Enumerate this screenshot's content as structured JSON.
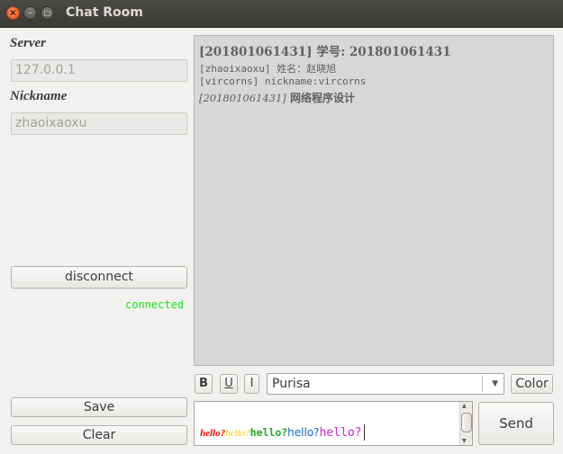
{
  "window": {
    "title": "Chat Room",
    "close_glyph": "×",
    "min_glyph": "–",
    "max_glyph": "□"
  },
  "sidebar": {
    "server_label": "Server",
    "server_value": "127.0.0.1",
    "nickname_label": "Nickname",
    "nickname_value": "zhaoixaoxu",
    "disconnect_label": "disconnect",
    "status_text": "connected",
    "status_color": "#22dd22",
    "save_label": "Save",
    "clear_label": "Clear"
  },
  "chat": {
    "line1": "[201801061431] 学号: 201801061431",
    "line2": "[zhaoixaoxu] 姓名：赵晓旭",
    "line3": "[vircorns] nickname:vircorns",
    "line4_sender": "[201801061431]",
    "line4_text": "网络程序设计"
  },
  "toolbar": {
    "bold_label": "B",
    "underline_label": "U",
    "italic_label": "I",
    "font_value": "Purisa",
    "color_label": "Color",
    "send_label": "Send"
  },
  "compose": {
    "segments": [
      {
        "text": "hello?",
        "color": "#ff0000"
      },
      {
        "text": "hello?",
        "color": "#ffcc00"
      },
      {
        "text": "hello?",
        "color": "#22aa22"
      },
      {
        "text": "hello?",
        "color": "#1166cc"
      },
      {
        "text": "hello?",
        "color": "#cc22cc"
      }
    ]
  }
}
